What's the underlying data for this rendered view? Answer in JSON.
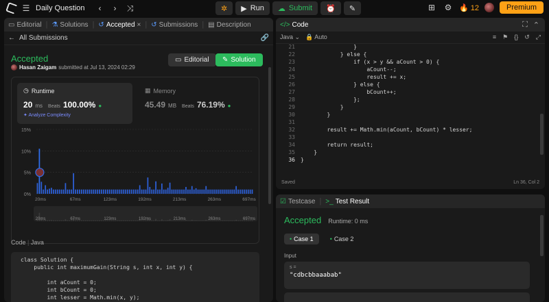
{
  "topbar": {
    "title": "Daily Question",
    "run_label": "Run",
    "submit_label": "Submit",
    "streak": "12",
    "premium_label": "Premium"
  },
  "left": {
    "tabs": [
      "Editorial",
      "Solutions",
      "Accepted",
      "Submissions",
      "Description"
    ],
    "back_label": "All Submissions",
    "status": "Accepted",
    "user": "Hasan Zaigam",
    "submitted_text": "submitted at Jul 13, 2024 02:29",
    "editorial_btn": "Editorial",
    "solution_btn": "Solution",
    "runtime": {
      "label": "Runtime",
      "value": "20",
      "unit": "ms",
      "beats_label": "Beats",
      "beats": "100.00%",
      "analyze": "Analyze Complexity"
    },
    "memory": {
      "label": "Memory",
      "value": "45.49",
      "unit": "MB",
      "beats_label": "Beats",
      "beats": "76.19%"
    },
    "code_label": "Code",
    "code_lang": "Java",
    "code_lines": [
      "class Solution {",
      "    public int maximumGain(String s, int x, int y) {",
      "",
      "        int aCount = 0;",
      "        int bCount = 0;",
      "        int lesser = Math.min(x, y);"
    ]
  },
  "chart_data": {
    "type": "bar",
    "y_ticks": [
      "15%",
      "10%",
      "5%",
      "0%"
    ],
    "x_tick_labels": [
      "20ms",
      "67ms",
      "123ms",
      "192ms",
      "213ms",
      "263ms",
      "697ms"
    ],
    "ylim": [
      0,
      15
    ],
    "highlight_index": 1,
    "values": [
      2.5,
      10.5,
      2.8,
      1,
      2,
      1,
      1.2,
      1.4,
      1,
      1,
      1,
      1,
      1,
      1,
      2.5,
      1,
      1,
      1,
      4.8,
      1,
      1,
      1,
      1,
      1,
      1,
      1,
      1,
      1,
      1,
      1,
      1,
      1,
      1,
      1,
      1,
      1,
      1,
      1,
      1,
      1,
      1,
      1,
      1,
      1,
      1,
      1,
      1,
      1,
      1,
      1,
      1,
      2,
      1,
      1,
      1,
      3.8,
      1.6,
      1,
      1,
      2.9,
      1,
      1,
      2.4,
      1,
      1,
      1.4,
      2.6,
      1,
      1,
      1,
      1,
      1,
      1,
      1,
      1.6,
      1,
      1,
      1.8,
      1,
      1.3,
      1,
      1,
      1,
      1,
      1.8,
      1,
      1,
      1,
      1,
      1,
      1,
      1,
      1,
      1,
      1,
      1,
      1,
      1,
      1,
      1.8,
      1,
      1,
      1,
      1,
      1,
      1,
      1,
      1
    ]
  },
  "right": {
    "code_tab": "Code",
    "lang": "Java",
    "auto": "Auto",
    "lines": [
      {
        "n": "21",
        "t": "                }"
      },
      {
        "n": "22",
        "t": "            } else {"
      },
      {
        "n": "23",
        "t": "                if (x > y && aCount > 0) {"
      },
      {
        "n": "24",
        "t": "                    aCount--;"
      },
      {
        "n": "25",
        "t": "                    result += x;"
      },
      {
        "n": "26",
        "t": "                } else {"
      },
      {
        "n": "27",
        "t": "                    bCount++;"
      },
      {
        "n": "28",
        "t": "                };"
      },
      {
        "n": "29",
        "t": "            }"
      },
      {
        "n": "30",
        "t": "        }"
      },
      {
        "n": "31",
        "t": ""
      },
      {
        "n": "32",
        "t": "        result += Math.min(aCount, bCount) * lesser;"
      },
      {
        "n": "33",
        "t": ""
      },
      {
        "n": "34",
        "t": "        return result;"
      },
      {
        "n": "35",
        "t": "    }"
      },
      {
        "n": "36",
        "t": "}"
      }
    ],
    "saved": "Saved",
    "cursor": "Ln 36, Col 2",
    "testcase_tab": "Testcase",
    "result_tab": "Test Result",
    "result_status": "Accepted",
    "result_runtime": "Runtime: 0 ms",
    "case1": "Case 1",
    "case2": "Case 2",
    "input_label": "Input",
    "input_key": "s =",
    "input_value": "\"cdbcbbaaabab\""
  }
}
